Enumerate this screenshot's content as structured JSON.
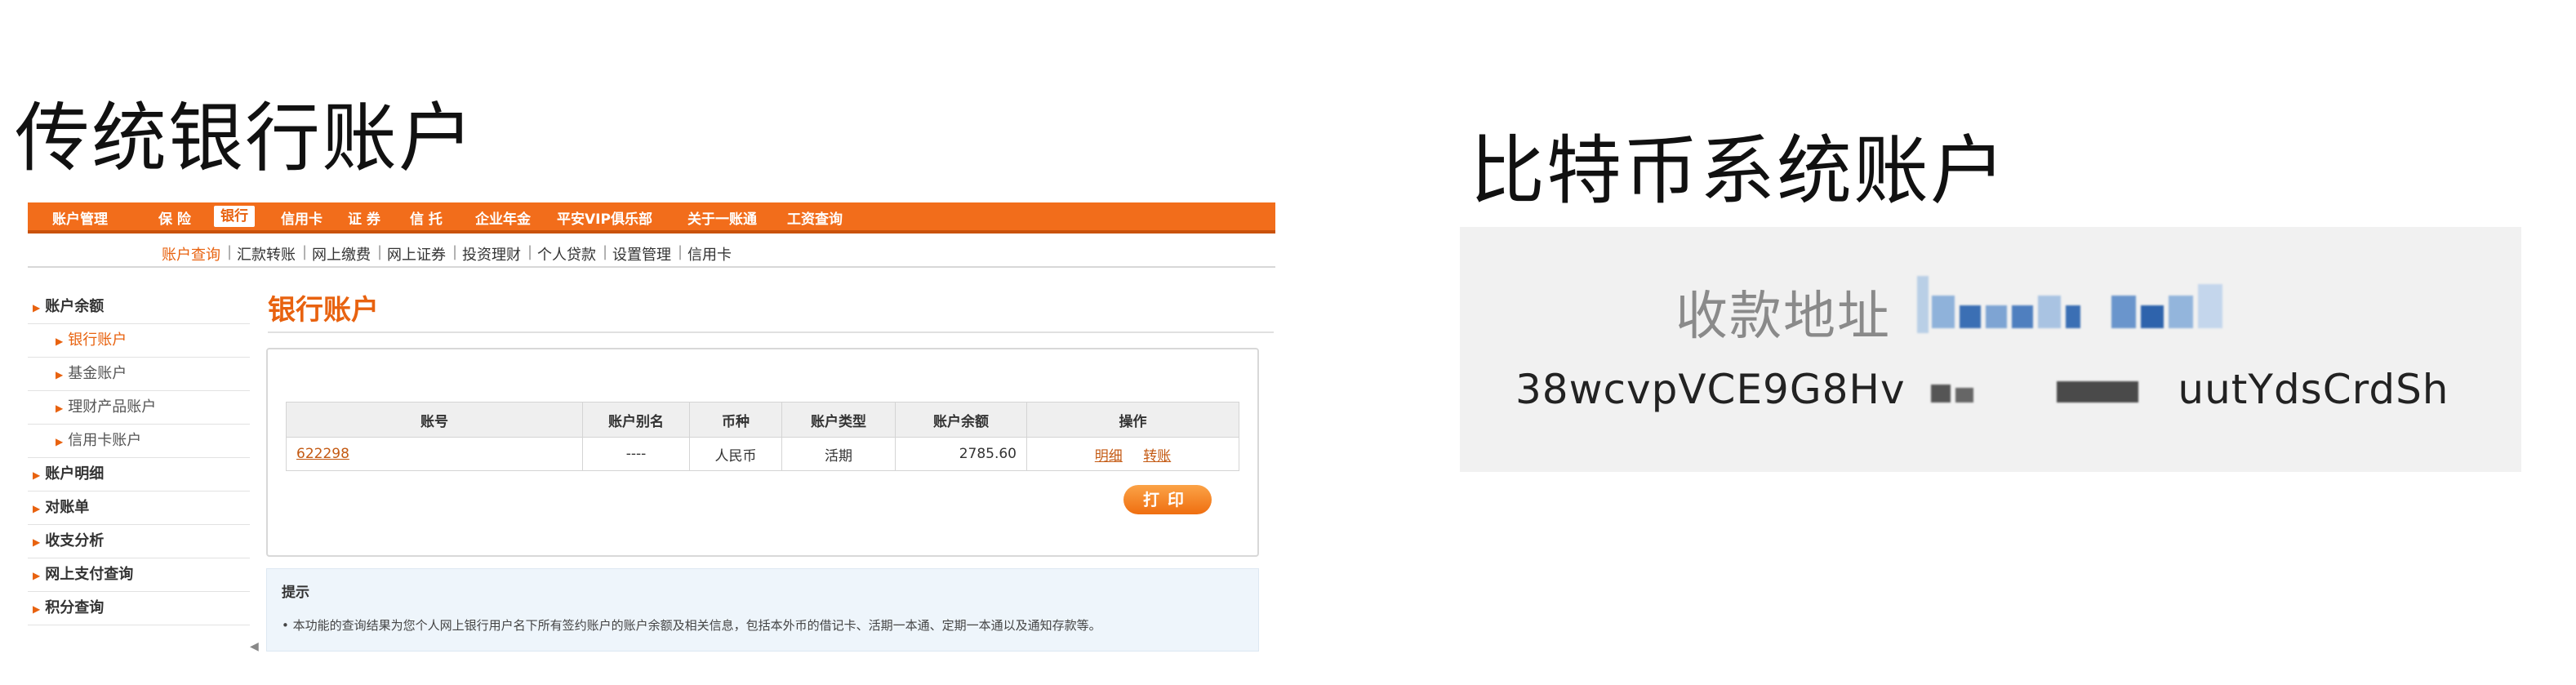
{
  "left_title": "传统银行账户",
  "right_title": "比特币系统账户",
  "bank": {
    "top_nav": [
      "账户管理",
      "保 险",
      "银行",
      "信用卡",
      "证 券",
      "信 托",
      "企业年金",
      "平安VIP俱乐部",
      "关于一账通",
      "工资查询"
    ],
    "active_top": "银行",
    "sub_nav": [
      "账户查询",
      "汇款转账",
      "网上缴费",
      "网上证券",
      "投资理财",
      "个人贷款",
      "设置管理",
      "信用卡"
    ],
    "active_sub": "账户查询",
    "sidebar": [
      {
        "label": "账户余额",
        "level": 1
      },
      {
        "label": "银行账户",
        "level": 2,
        "active": true
      },
      {
        "label": "基金账户",
        "level": 2
      },
      {
        "label": "理财产品账户",
        "level": 2
      },
      {
        "label": "信用卡账户",
        "level": 2
      },
      {
        "label": "账户明细",
        "level": 1
      },
      {
        "label": "对账单",
        "level": 1
      },
      {
        "label": "收支分析",
        "level": 1
      },
      {
        "label": "网上支付查询",
        "level": 1
      },
      {
        "label": "积分查询",
        "level": 1
      }
    ],
    "page_heading": "银行账户",
    "table": {
      "headers": [
        "账号",
        "账户别名",
        "币种",
        "账户类型",
        "账户余额",
        "操作"
      ],
      "row": {
        "account": "622298",
        "alias": "----",
        "currency": "人民币",
        "type": "活期",
        "balance": "2785.60",
        "op1": "明细",
        "op2": "转账"
      }
    },
    "print_label": "打印",
    "tips_title": "提示",
    "tips_text": "• 本功能的查询结果为您个人网上银行用户名下所有签约账户的账户余额及相关信息，包括本外币的借记卡、活期一本通、定期一本通以及通知存款等。"
  },
  "btc": {
    "address_label": "收款地址",
    "address_prefix": "38wcvpVCE9G8Hv",
    "address_suffix": "uutYdsCrdSh"
  },
  "colors": {
    "accent": "#f26d1b",
    "link": "#c45a13",
    "panel": "#f1f1f1"
  }
}
